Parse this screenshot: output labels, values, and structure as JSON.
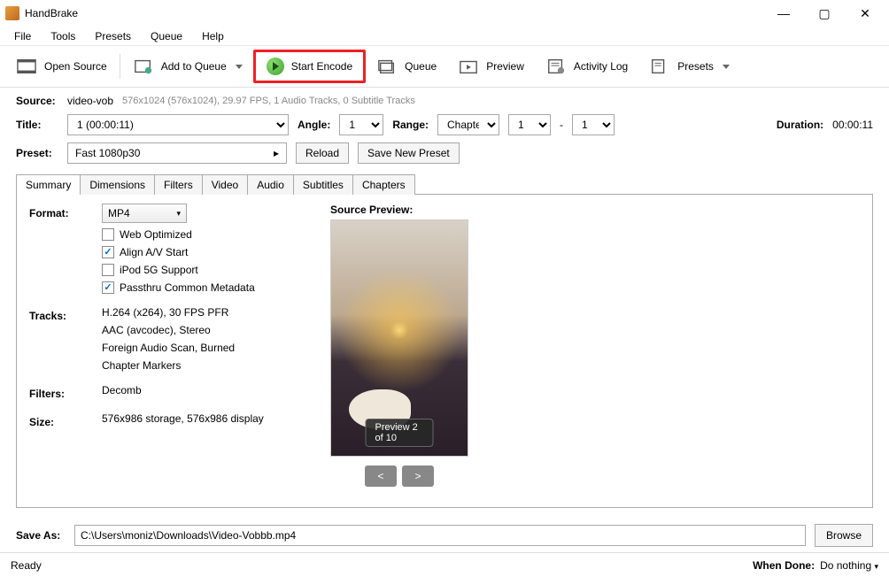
{
  "app": {
    "title": "HandBrake"
  },
  "menu": {
    "file": "File",
    "tools": "Tools",
    "presets": "Presets",
    "queue": "Queue",
    "help": "Help"
  },
  "toolbar": {
    "open_source": "Open Source",
    "add_to_queue": "Add to Queue",
    "start_encode": "Start Encode",
    "queue": "Queue",
    "preview": "Preview",
    "activity_log": "Activity Log",
    "presets": "Presets"
  },
  "source": {
    "label": "Source:",
    "name": "video-vob",
    "info": "576x1024 (576x1024), 29.97 FPS, 1 Audio Tracks, 0 Subtitle Tracks"
  },
  "title": {
    "label": "Title:",
    "value": "1  (00:00:11)"
  },
  "angle": {
    "label": "Angle:",
    "value": "1"
  },
  "range": {
    "label": "Range:",
    "value": "Chapters",
    "from": "1",
    "dash": "-",
    "to": "1"
  },
  "duration": {
    "label": "Duration:",
    "value": "00:00:11"
  },
  "preset": {
    "label": "Preset:",
    "value": "Fast 1080p30",
    "reload": "Reload",
    "save_new": "Save New Preset"
  },
  "tabs": {
    "summary": "Summary",
    "dimensions": "Dimensions",
    "filters": "Filters",
    "video": "Video",
    "audio": "Audio",
    "subtitles": "Subtitles",
    "chapters": "Chapters"
  },
  "summary": {
    "format_label": "Format:",
    "format_value": "MP4",
    "web_optimized": "Web Optimized",
    "align_av": "Align A/V Start",
    "ipod": "iPod 5G Support",
    "passthru": "Passthru Common Metadata",
    "tracks_label": "Tracks:",
    "track1": "H.264 (x264), 30 FPS PFR",
    "track2": "AAC (avcodec), Stereo",
    "track3": "Foreign Audio Scan, Burned",
    "track4": "Chapter Markers",
    "filters_label": "Filters:",
    "filters_value": "Decomb",
    "size_label": "Size:",
    "size_value": "576x986 storage, 576x986 display",
    "preview_label": "Source Preview:",
    "preview_badge": "Preview 2 of 10",
    "prev": "<",
    "next": ">"
  },
  "saveas": {
    "label": "Save As:",
    "value": "C:\\Users\\moniz\\Downloads\\Video-Vobbb.mp4",
    "browse": "Browse"
  },
  "status": {
    "ready": "Ready",
    "when_done_label": "When Done:",
    "when_done_value": "Do nothing"
  }
}
